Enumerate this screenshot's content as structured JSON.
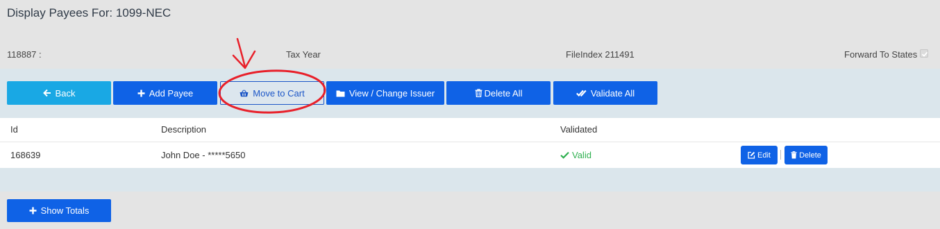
{
  "page": {
    "title": "Display Payees For: 1099-NEC"
  },
  "info": {
    "issuer_id": "118887 :",
    "tax_year_label": "Tax Year",
    "file_index": "FileIndex 211491",
    "forward_label": "Forward To States",
    "forward_checked": true
  },
  "toolbar": {
    "back": "Back",
    "add_payee": "Add Payee",
    "move_to_cart": "Move to Cart",
    "view_change_issuer": "View / Change Issuer",
    "delete_all": "Delete All",
    "validate_all": "Validate All"
  },
  "table": {
    "columns": [
      "Id",
      "Description",
      "Validated"
    ],
    "rows": [
      {
        "id": "168639",
        "description": "John Doe - *****5650",
        "status": "Valid",
        "edit": "Edit",
        "delete": "Delete"
      }
    ]
  },
  "footer": {
    "show_totals": "Show Totals"
  },
  "icons": {
    "back": "arrow-left-icon",
    "add": "plus-icon",
    "cart": "basket-icon",
    "folder": "folder-icon",
    "trash": "trash-icon",
    "validate": "double-check-icon",
    "edit": "edit-icon",
    "valid": "check-icon"
  },
  "colors": {
    "primary": "#0f62e6",
    "back": "#19a8e4",
    "valid": "#2fb050",
    "annotation": "#e8202a"
  }
}
